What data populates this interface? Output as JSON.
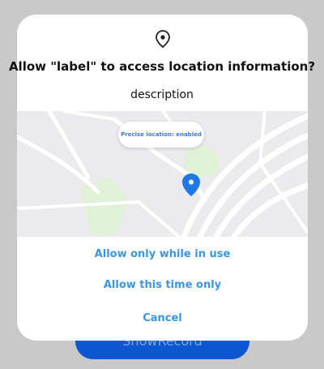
{
  "background_button": {
    "label": "ShowRecord"
  },
  "dialog": {
    "icon": "location-pin-icon",
    "title": "Allow \"label\" to access location information?",
    "description": "description",
    "map": {
      "precise_location_text": "Precise location: enabled",
      "marker_icon": "map-marker-icon"
    },
    "actions": [
      {
        "label": "Allow only while in use"
      },
      {
        "label": "Allow this time only"
      },
      {
        "label": "Cancel"
      }
    ]
  },
  "colors": {
    "accent": "#3a96e6",
    "marker": "#1f78e6",
    "scrim": "#c9c9c9",
    "background_button": "#0b57cf",
    "map_base": "#ebebed",
    "park": "#dff2d6"
  }
}
